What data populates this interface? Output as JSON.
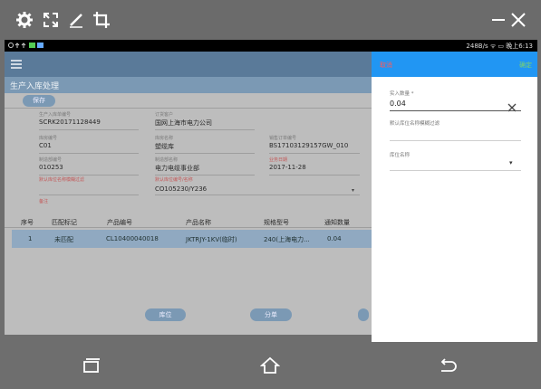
{
  "statusbar": {
    "right_text": "248B/s ᯤ ▭ 晚上6:13"
  },
  "app": {
    "title": "生产入库处理",
    "save_label": "保存",
    "fields": {
      "order_no_label": "生产入库单编号",
      "order_no": "SCRK20171128449",
      "customer_label": "订货客户",
      "customer": "国网上海市电力公司",
      "warehouse_code_label": "库房编号",
      "warehouse_code": "C01",
      "warehouse_name_label": "库房名称",
      "warehouse_name": "塑缆库",
      "sales_order_label": "销售订单编号",
      "sales_order": "BS17103129157GW_010",
      "dept_code_label": "制造部编号",
      "dept_code": "010253",
      "dept_name_label": "制造部名称",
      "dept_name": "电力电缆事业部",
      "entry_date_label": "业务日期",
      "entry_date": "2017-11-28",
      "default_loc_filter_label": "默认库位名称模糊过滤",
      "default_loc_label": "默认库位编号/名称",
      "default_loc": "CO105230/Y236",
      "remark_label": "备注"
    },
    "table": {
      "headers": [
        "序号",
        "匹配标记",
        "产品编号",
        "产品名称",
        "规格型号",
        "通知数量"
      ],
      "rows": [
        [
          "1",
          "未匹配",
          "CL10400040018",
          "JKTRJY-1KV(临时)",
          "240(上海电力...",
          "0.04"
        ]
      ]
    },
    "buttons": {
      "location": "库位",
      "split": "分单"
    }
  },
  "sheet": {
    "cancel": "取消",
    "confirm": "确定",
    "qty_label": "实入数量 *",
    "qty_value": "0.04",
    "loc_filter_label": "默认库位名称模糊过滤",
    "loc_name_label": "库位名称"
  }
}
